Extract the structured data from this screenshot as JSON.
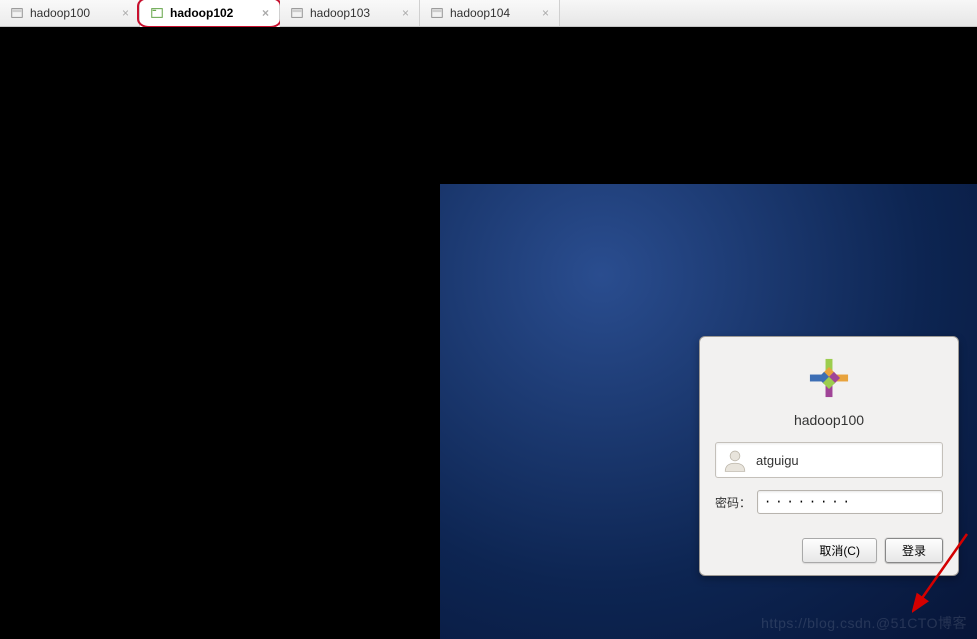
{
  "tabs": [
    {
      "label": "hadoop100"
    },
    {
      "label": "hadoop102"
    },
    {
      "label": "hadoop103"
    },
    {
      "label": "hadoop104"
    }
  ],
  "login": {
    "hostname": "hadoop100",
    "username": "atguigu",
    "password_label": "密码：",
    "password_value": "········",
    "cancel_label": "取消(C)",
    "submit_label": "登录"
  },
  "watermark": "https://blog.csdn.@51CTO博客"
}
